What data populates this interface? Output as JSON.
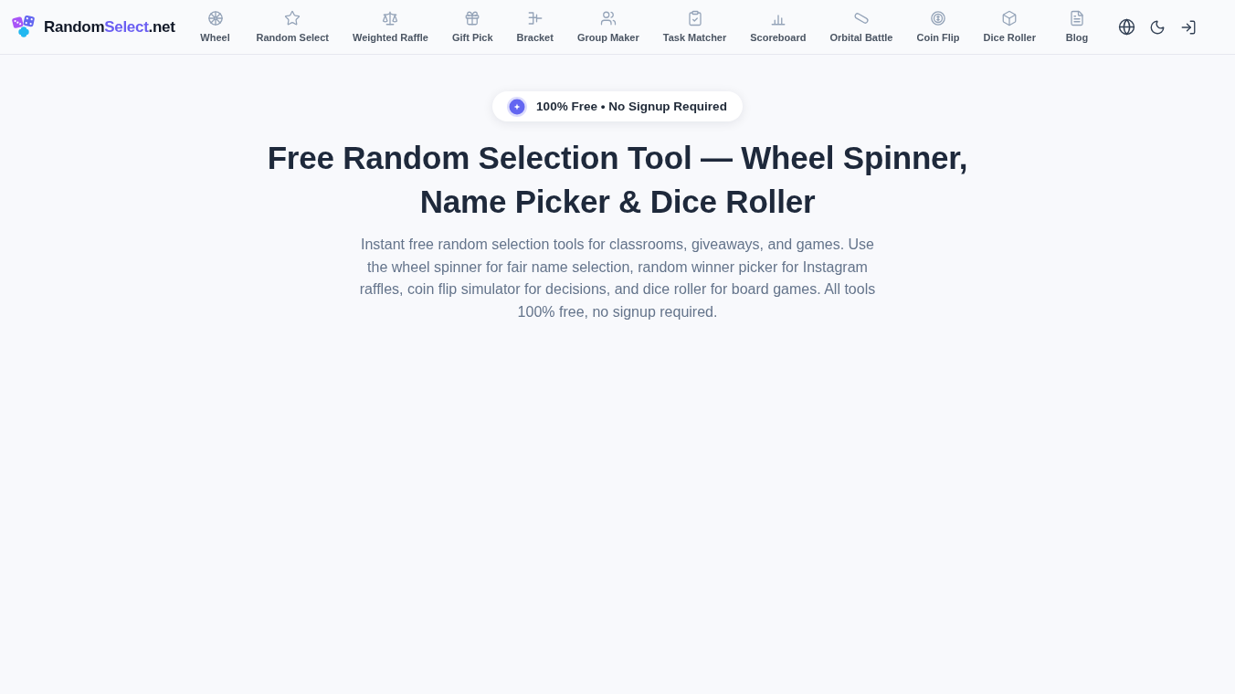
{
  "header": {
    "logo": {
      "name": "Random",
      "highlight": "Select",
      "suffix": ".net"
    },
    "nav": [
      {
        "label": "Wheel"
      },
      {
        "label": "Random Select"
      },
      {
        "label": "Weighted Raffle"
      },
      {
        "label": "Gift Pick"
      },
      {
        "label": "Bracket"
      },
      {
        "label": "Group Maker"
      },
      {
        "label": "Task Matcher"
      },
      {
        "label": "Scoreboard"
      },
      {
        "label": "Orbital Battle"
      },
      {
        "label": "Coin Flip"
      },
      {
        "label": "Dice Roller"
      },
      {
        "label": "Blog"
      }
    ]
  },
  "hero": {
    "badge": "100% Free • No Signup Required",
    "title": "Free Random Selection Tool — Wheel Spinner, Name Picker & Dice Roller",
    "description": "Instant free random selection tools for classrooms, giveaways, and games. Use the wheel spinner for fair name selection, random winner picker for Instagram raffles, coin flip simulator for decisions, and dice roller for board games. All tools 100% free, no signup required."
  }
}
